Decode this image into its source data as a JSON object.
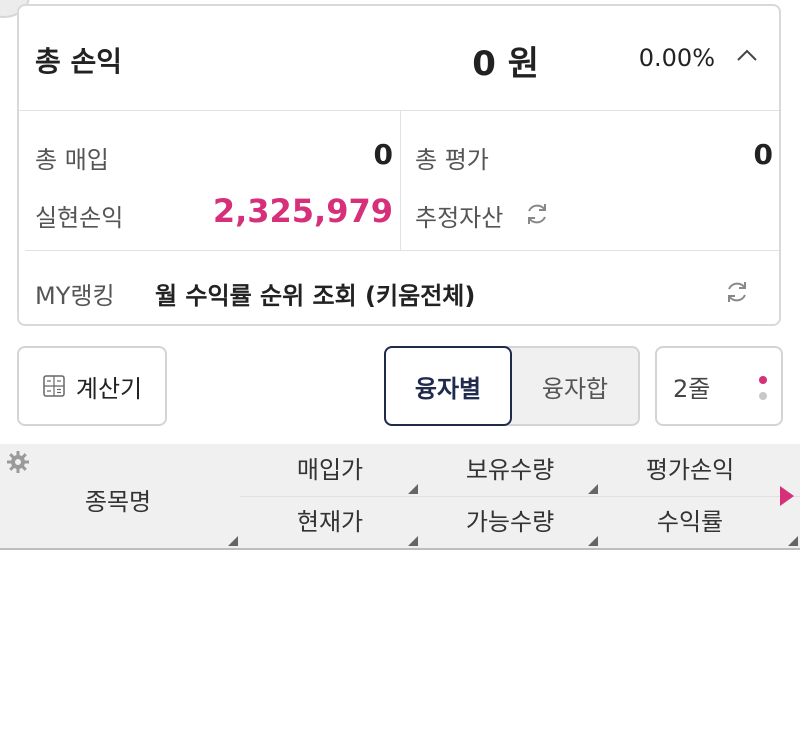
{
  "summary": {
    "title": "총 손익",
    "amount": "0",
    "unit": "원",
    "rate": "0.00%",
    "total_purchase_label": "총 매입",
    "total_purchase_value": "0",
    "total_eval_label": "총 평가",
    "total_eval_value": "0",
    "realized_label": "실현손익",
    "realized_value": "2,325,979",
    "estimated_assets_label": "추정자산",
    "ranking_label": "MY랭킹",
    "ranking_link": "월 수익률 순위 조회 (키움전체)"
  },
  "controls": {
    "calculator_label": "계산기",
    "seg_by_loan": "융자별",
    "seg_loan_sum": "융자합",
    "lines_label": "2줄"
  },
  "table": {
    "name_header": "종목명",
    "row1": [
      "매입가",
      "보유수량",
      "평가손익"
    ],
    "row2": [
      "현재가",
      "가능수량",
      "수익률"
    ]
  },
  "colors": {
    "accent_pink": "#d6307a",
    "active_navy": "#1f2a4d"
  },
  "icons": {
    "collapse": "chevron-up-icon",
    "refresh": "refresh-icon",
    "calculator": "calculator-icon",
    "settings": "gear-icon",
    "scroll": "triangle-right-icon"
  }
}
